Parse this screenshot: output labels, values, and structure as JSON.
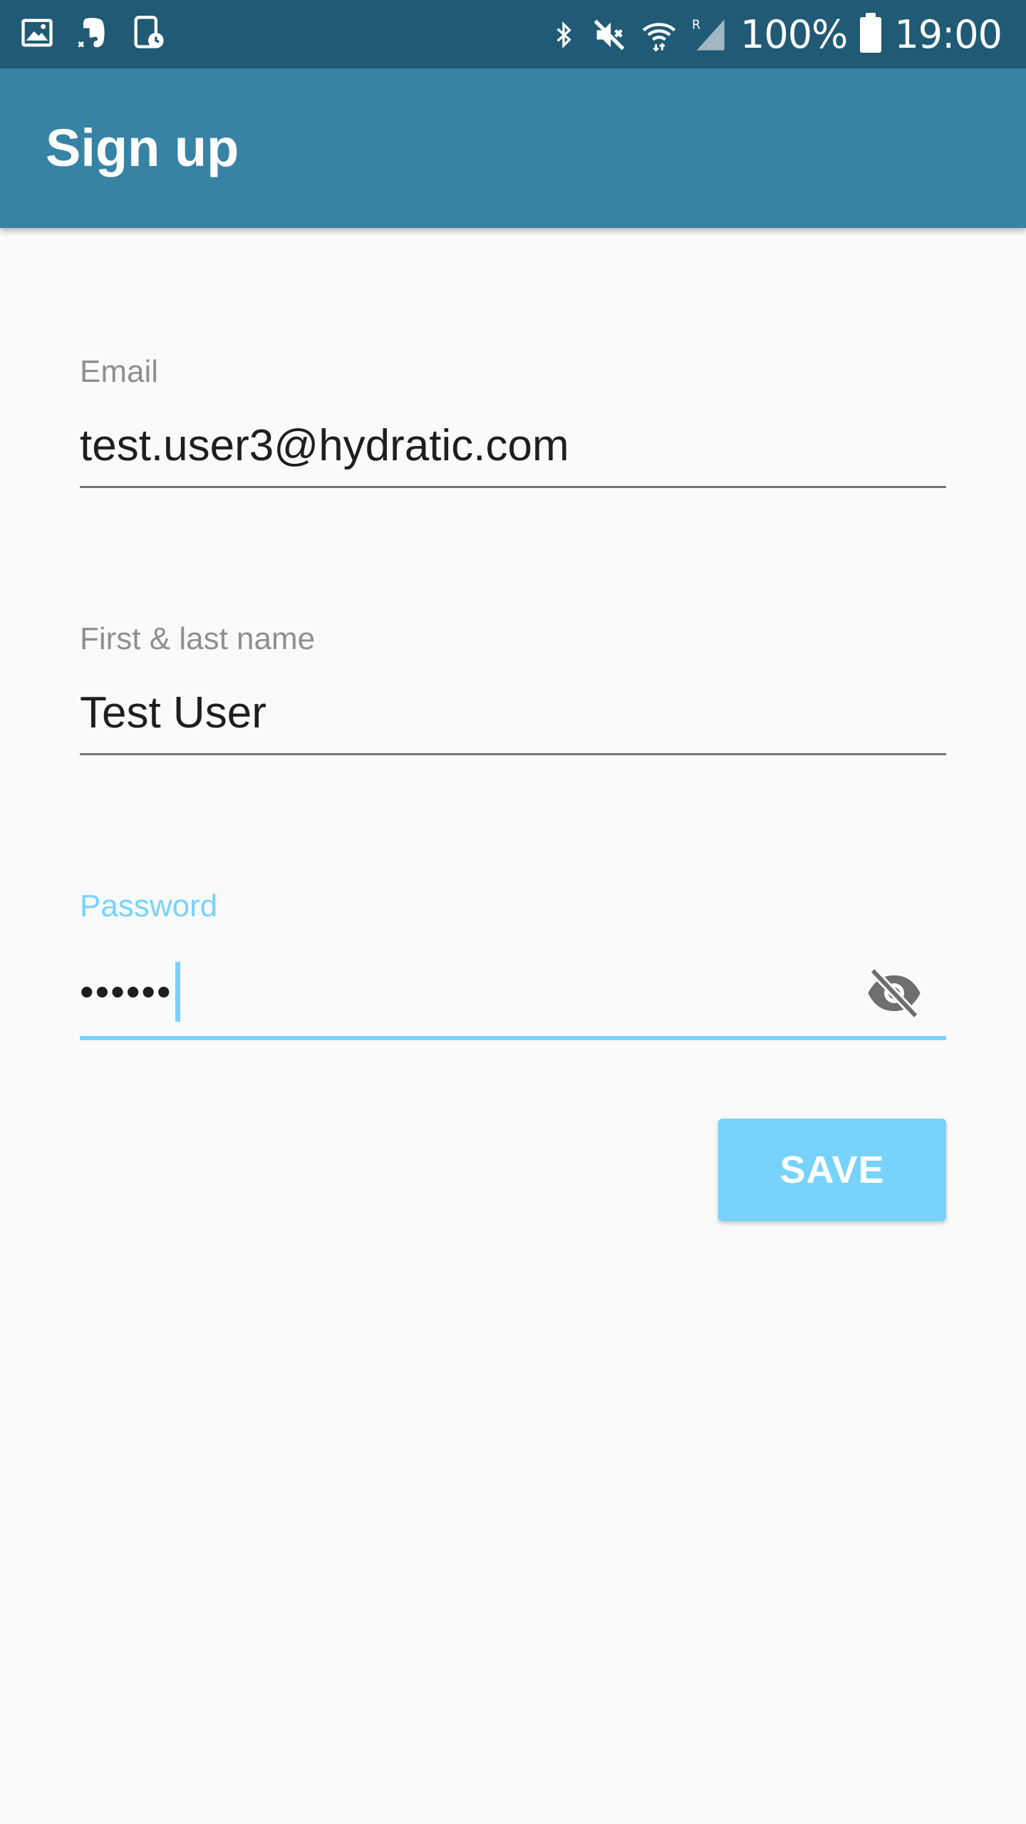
{
  "status_bar": {
    "left_icons": [
      "gallery-icon",
      "evernote-icon",
      "screen-record-icon"
    ],
    "right_icons": [
      "bluetooth-icon",
      "mute-icon",
      "wifi-icon",
      "signal-icon"
    ],
    "battery_text": "100%",
    "time": "19:00"
  },
  "app_bar": {
    "title": "Sign up",
    "color": "#3783a5"
  },
  "form": {
    "email": {
      "label": "Email",
      "value": "test.user3@hydratic.com"
    },
    "name": {
      "label": "First & last name",
      "value": "Test User"
    },
    "password": {
      "label": "Password",
      "masked_value": "••••••",
      "toggle_icon": "visibility-off-icon"
    },
    "save_label": "SAVE"
  },
  "colors": {
    "status_bar": "#205a75",
    "accent": "#77d3fd",
    "label": "#8f8f8f",
    "background": "#fafafa"
  }
}
